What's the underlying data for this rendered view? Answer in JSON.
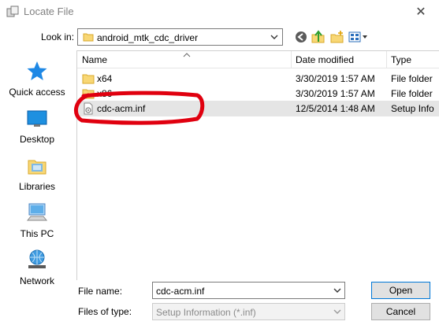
{
  "window": {
    "title": "Locate File",
    "close_glyph": "✕"
  },
  "lookin": {
    "label": "Look in:",
    "value": "android_mtk_cdc_driver"
  },
  "toolbar": [
    "back-icon",
    "up-folder-icon",
    "new-folder-icon",
    "view-menu-icon"
  ],
  "places": [
    {
      "label": "Quick access",
      "icon": "star-icon"
    },
    {
      "label": "Desktop",
      "icon": "desktop-icon"
    },
    {
      "label": "Libraries",
      "icon": "libraries-icon"
    },
    {
      "label": "This PC",
      "icon": "computer-icon"
    },
    {
      "label": "Network",
      "icon": "network-icon"
    }
  ],
  "columns": {
    "name": "Name",
    "date": "Date modified",
    "type": "Type"
  },
  "files": [
    {
      "name": "x64",
      "date": "3/30/2019 1:57 AM",
      "type": "File folder",
      "icon": "folder-icon",
      "selected": false
    },
    {
      "name": "x86",
      "date": "3/30/2019 1:57 AM",
      "type": "File folder",
      "icon": "folder-icon",
      "selected": false
    },
    {
      "name": "cdc-acm.inf",
      "date": "12/5/2014 1:48 AM",
      "type": "Setup Info",
      "icon": "setup-file-icon",
      "selected": true
    }
  ],
  "filename": {
    "label": "File name:",
    "value": "cdc-acm.inf"
  },
  "filetype": {
    "label": "Files of type:",
    "value": "Setup Information (*.inf)"
  },
  "buttons": {
    "open": "Open",
    "cancel": "Cancel"
  },
  "colors": {
    "selection": "#e5e5e5",
    "annotation": "#e0000f",
    "folder": "#f8d775",
    "accent": "#0078d7"
  }
}
